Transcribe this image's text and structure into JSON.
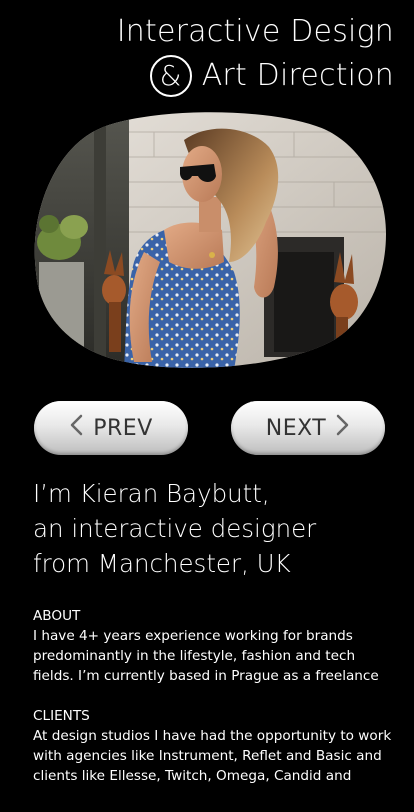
{
  "header": {
    "title_line1": "Interactive Design",
    "ampersand": "&",
    "title_line2": "Art Direction"
  },
  "hero": {
    "image_name": "portrait-photo"
  },
  "nav": {
    "prev_label": "PREV",
    "next_label": "NEXT",
    "prev_icon": "chevron-left-icon",
    "next_icon": "chevron-right-icon"
  },
  "intro": {
    "line1": "I’m Kieran Baybutt,",
    "line2": "an interactive designer",
    "line3": "from Manchester, UK"
  },
  "about": {
    "heading": "ABOUT",
    "lines": [
      "I have 4+ years experience working for brands",
      "predominantly in the lifestyle, fashion and tech",
      "fields. I’m currently based in Prague as a freelance"
    ]
  },
  "clients": {
    "heading": "CLIENTS",
    "lines": [
      "At design studios I have had the opportunity to work",
      "with agencies like Instrument, Reflet and Basic and",
      "clients like Ellesse, Twitch, Omega, Candid and"
    ]
  },
  "colors": {
    "background": "#000000",
    "text": "#ffffff",
    "button_text": "#333333"
  }
}
